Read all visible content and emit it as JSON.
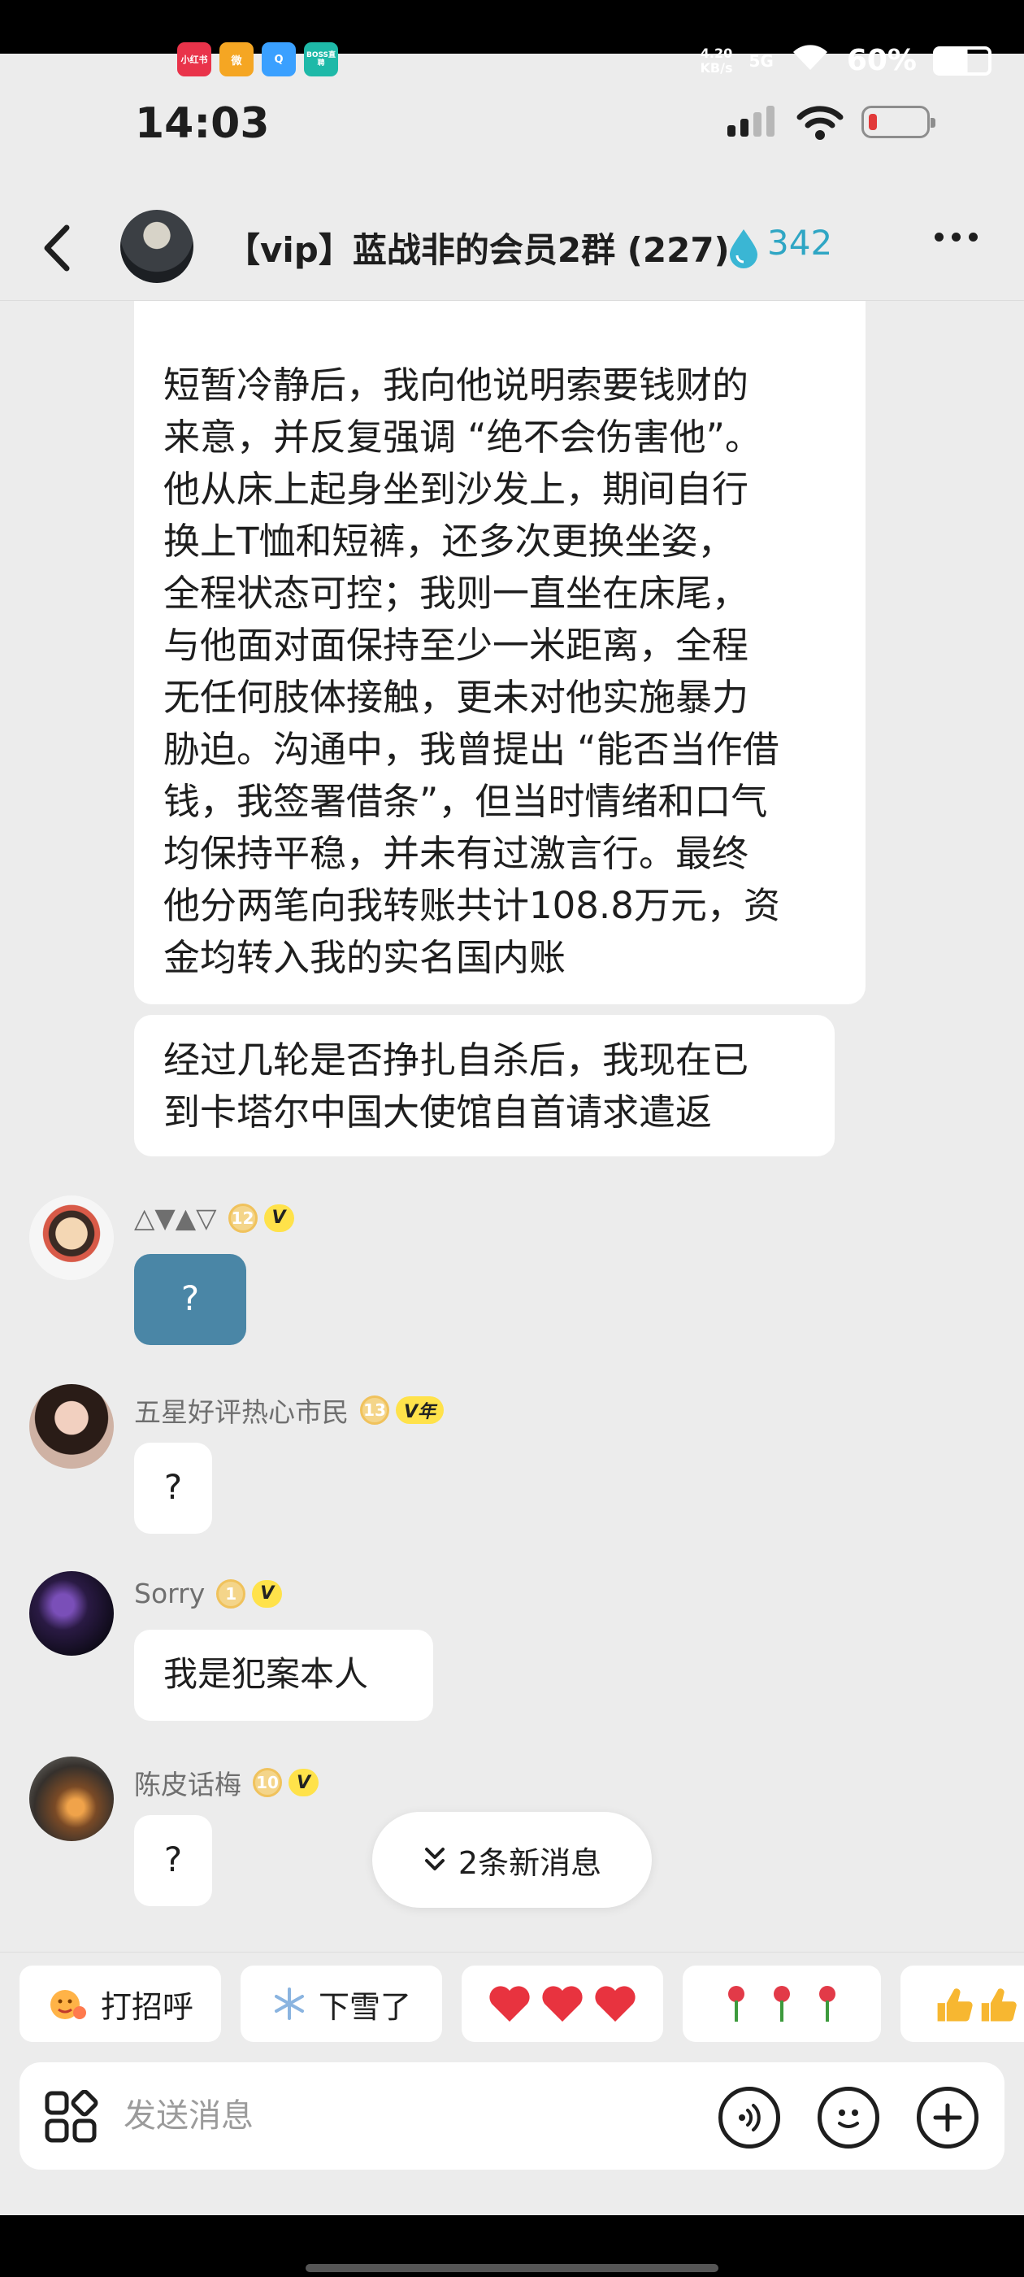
{
  "outer_status": {
    "apps": [
      {
        "name": "jiangsu-app",
        "label": "小红书",
        "color": "#e9334a"
      },
      {
        "name": "weibo-app",
        "label": "微",
        "color": "#f5a623"
      },
      {
        "name": "browser-app",
        "label": "Q",
        "color": "#3aa0ff"
      },
      {
        "name": "boss-app",
        "label": "BOSS直聘",
        "color": "#1eb9a8"
      }
    ],
    "net_speed": "4.20\nKB/s",
    "net_type": "5G",
    "battery": "60%"
  },
  "status": {
    "time": "14:03"
  },
  "header": {
    "title": "【vip】蓝战非的会员2群 (227)",
    "heat": "342"
  },
  "messages": {
    "long_text": "短暂冷静后，我向他说明索要钱财的\n来意，并反复强调 “绝不会伤害他”。\n他从床上起身坐到沙发上，期间自行\n换上T恤和短裤，还多次更换坐姿，\n全程状态可控；我则一直坐在床尾，\n与他面对面保持至少一米距离，全程\n无任何肢体接触，更未对他实施暴力\n胁迫。沟通中，我曾提出 “能否当作借\n钱，我签署借条”，但当时情绪和口气\n均保持平稳，并未有过激言行。最终\n他分两笔向我转账共计108.8万元，资\n金均转入我的实名国内账",
    "embassy_text": "经过几轮是否挣扎自杀后，我现在已\n到卡塔尔中国大使馆自首请求遣返",
    "senders": [
      {
        "name": "△▼▲▽",
        "level": "12",
        "vip": "V",
        "reply": "?"
      },
      {
        "name": "五星好评热心市民",
        "level": "13",
        "vip": "V年",
        "reply": "?"
      },
      {
        "name": "Sorry",
        "level": "1",
        "vip": "V",
        "reply": "我是犯案本人"
      },
      {
        "name": "陈皮话梅",
        "level": "10",
        "vip": "V",
        "reply": "?"
      }
    ]
  },
  "new_messages": {
    "label": "2条新消息"
  },
  "quick_replies": {
    "greet": "打招呼",
    "snow": "下雪了"
  },
  "input": {
    "placeholder": "发送消息"
  }
}
